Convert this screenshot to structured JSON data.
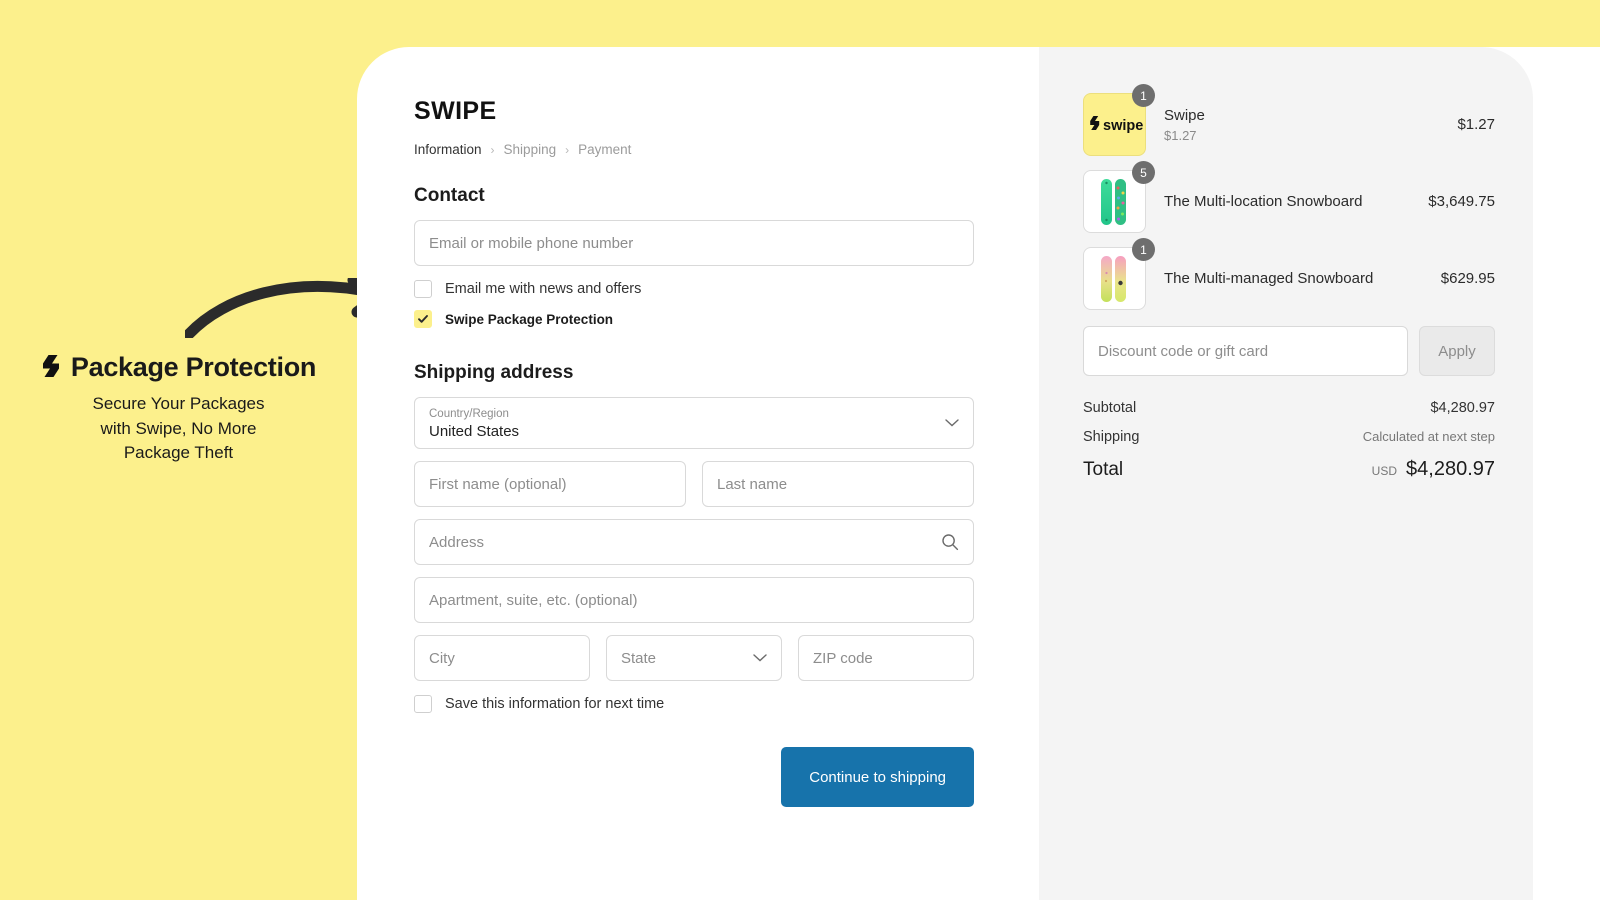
{
  "promo": {
    "title": "Package Protection",
    "logo_icon": "swipe-s-logo-icon",
    "arrow_icon": "curved-arrow-icon",
    "subtitle_lines": [
      "Secure Your Packages",
      "with Swipe, No More",
      "Package Theft"
    ],
    "background_color": "#fcf08c"
  },
  "checkout": {
    "brand": "SWIPE",
    "breadcrumb": [
      {
        "label": "Information",
        "active": true
      },
      {
        "label": "Shipping",
        "active": false
      },
      {
        "label": "Payment",
        "active": false
      }
    ],
    "breadcrumb_separator": "›",
    "contact": {
      "heading": "Contact",
      "email_placeholder": "Email or mobile phone number",
      "email_value": "",
      "checkboxes": [
        {
          "label": "Email me with news and offers",
          "checked": false
        },
        {
          "label": "Swipe Package Protection",
          "checked": true
        }
      ]
    },
    "shipping": {
      "heading": "Shipping address",
      "country_label": "Country/Region",
      "country_value": "United States",
      "first_name_placeholder": "First name (optional)",
      "first_name_value": "",
      "last_name_placeholder": "Last name",
      "last_name_value": "",
      "address_placeholder": "Address",
      "address_value": "",
      "apartment_placeholder": "Apartment, suite, etc. (optional)",
      "apartment_value": "",
      "city_placeholder": "City",
      "city_value": "",
      "state_placeholder": "State",
      "state_value": "",
      "zip_placeholder": "ZIP code",
      "zip_value": "",
      "save_info_label": "Save this information for next time",
      "save_info_checked": false
    },
    "continue_label": "Continue to shipping",
    "continue_color": "#1773ab"
  },
  "summary": {
    "items": [
      {
        "name": "Swipe",
        "subtitle": "$1.27",
        "qty": "1",
        "price": "$1.27",
        "thumb_kind": "swipe-logo",
        "thumb_label": "swipe"
      },
      {
        "name": "The Multi-location Snowboard",
        "subtitle": "",
        "qty": "5",
        "price": "$3,649.75",
        "thumb_kind": "snowboard-green",
        "thumb_label": ""
      },
      {
        "name": "The Multi-managed Snowboard",
        "subtitle": "",
        "qty": "1",
        "price": "$629.95",
        "thumb_kind": "snowboard-pink",
        "thumb_label": ""
      }
    ],
    "discount_placeholder": "Discount code or gift card",
    "discount_value": "",
    "apply_label": "Apply",
    "subtotal_label": "Subtotal",
    "subtotal_value": "$4,280.97",
    "shipping_label": "Shipping",
    "shipping_value": "Calculated at next step",
    "total_label": "Total",
    "total_currency": "USD",
    "total_value": "$4,280.97"
  }
}
